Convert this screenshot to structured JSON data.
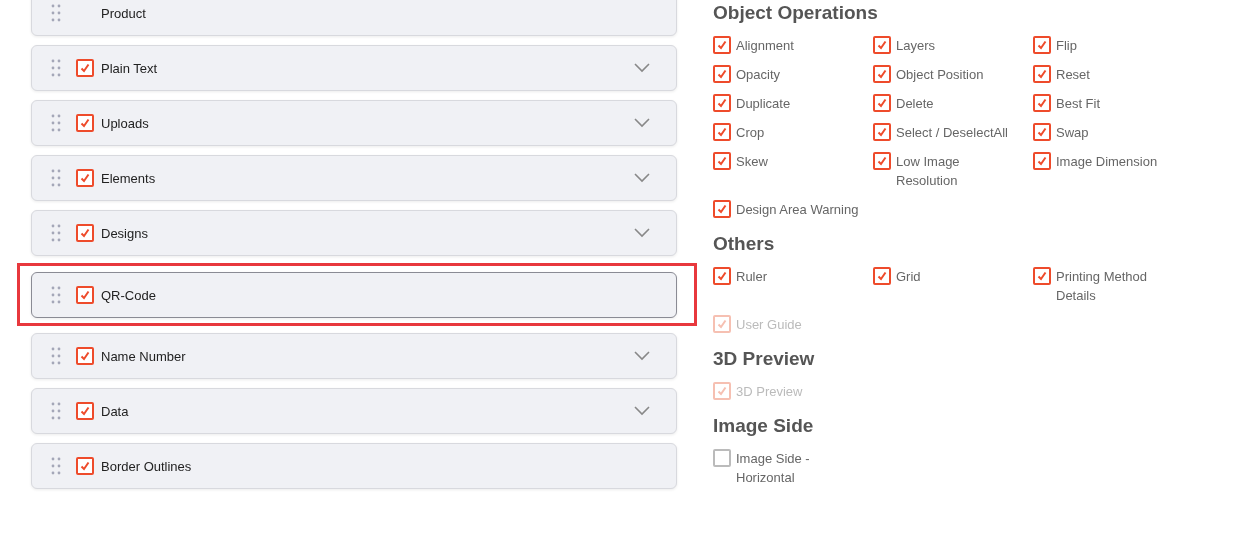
{
  "modules": [
    {
      "label": "Product",
      "checkbox": false,
      "expandable": false,
      "highlighted": false
    },
    {
      "label": "Plain Text",
      "checkbox": true,
      "checked": true,
      "expandable": true,
      "highlighted": false
    },
    {
      "label": "Uploads",
      "checkbox": true,
      "checked": true,
      "expandable": true,
      "highlighted": false
    },
    {
      "label": "Elements",
      "checkbox": true,
      "checked": true,
      "expandable": true,
      "highlighted": false
    },
    {
      "label": "Designs",
      "checkbox": true,
      "checked": true,
      "expandable": true,
      "highlighted": false
    },
    {
      "label": "QR-Code",
      "checkbox": true,
      "checked": true,
      "expandable": false,
      "highlighted": true
    },
    {
      "label": "Name Number",
      "checkbox": true,
      "checked": true,
      "expandable": true,
      "highlighted": false
    },
    {
      "label": "Data",
      "checkbox": true,
      "checked": true,
      "expandable": true,
      "highlighted": false
    },
    {
      "label": "Border Outlines",
      "checkbox": true,
      "checked": true,
      "expandable": false,
      "highlighted": false
    }
  ],
  "sections": [
    {
      "title": "Object Operations",
      "options": [
        {
          "label": "Alignment",
          "checked": true,
          "disabled": false
        },
        {
          "label": "Layers",
          "checked": true,
          "disabled": false
        },
        {
          "label": "Flip",
          "checked": true,
          "disabled": false
        },
        {
          "label": "Opacity",
          "checked": true,
          "disabled": false
        },
        {
          "label": "Object Position",
          "checked": true,
          "disabled": false
        },
        {
          "label": "Reset",
          "checked": true,
          "disabled": false
        },
        {
          "label": "Duplicate",
          "checked": true,
          "disabled": false
        },
        {
          "label": "Delete",
          "checked": true,
          "disabled": false
        },
        {
          "label": "Best Fit",
          "checked": true,
          "disabled": false
        },
        {
          "label": "Crop",
          "checked": true,
          "disabled": false
        },
        {
          "label": "Select / DeselectAll",
          "checked": true,
          "disabled": false
        },
        {
          "label": "Swap",
          "checked": true,
          "disabled": false
        },
        {
          "label": "Skew",
          "checked": true,
          "disabled": false
        },
        {
          "label": "Low Image Resolution",
          "checked": true,
          "disabled": false
        },
        {
          "label": "Image Dimension",
          "checked": true,
          "disabled": false
        },
        {
          "label": "Design Area Warning",
          "checked": true,
          "disabled": false
        }
      ]
    },
    {
      "title": "Others",
      "options": [
        {
          "label": "Ruler",
          "checked": true,
          "disabled": false
        },
        {
          "label": "Grid",
          "checked": true,
          "disabled": false
        },
        {
          "label": "Printing Method Details",
          "checked": true,
          "disabled": false
        },
        {
          "label": "User Guide",
          "checked": true,
          "disabled": true
        }
      ]
    },
    {
      "title": "3D Preview",
      "options": [
        {
          "label": "3D Preview",
          "checked": true,
          "disabled": true
        }
      ]
    },
    {
      "title": "Image Side",
      "options": [
        {
          "label": "Image Side - Horizontal",
          "checked": false,
          "disabled": false
        }
      ]
    }
  ]
}
